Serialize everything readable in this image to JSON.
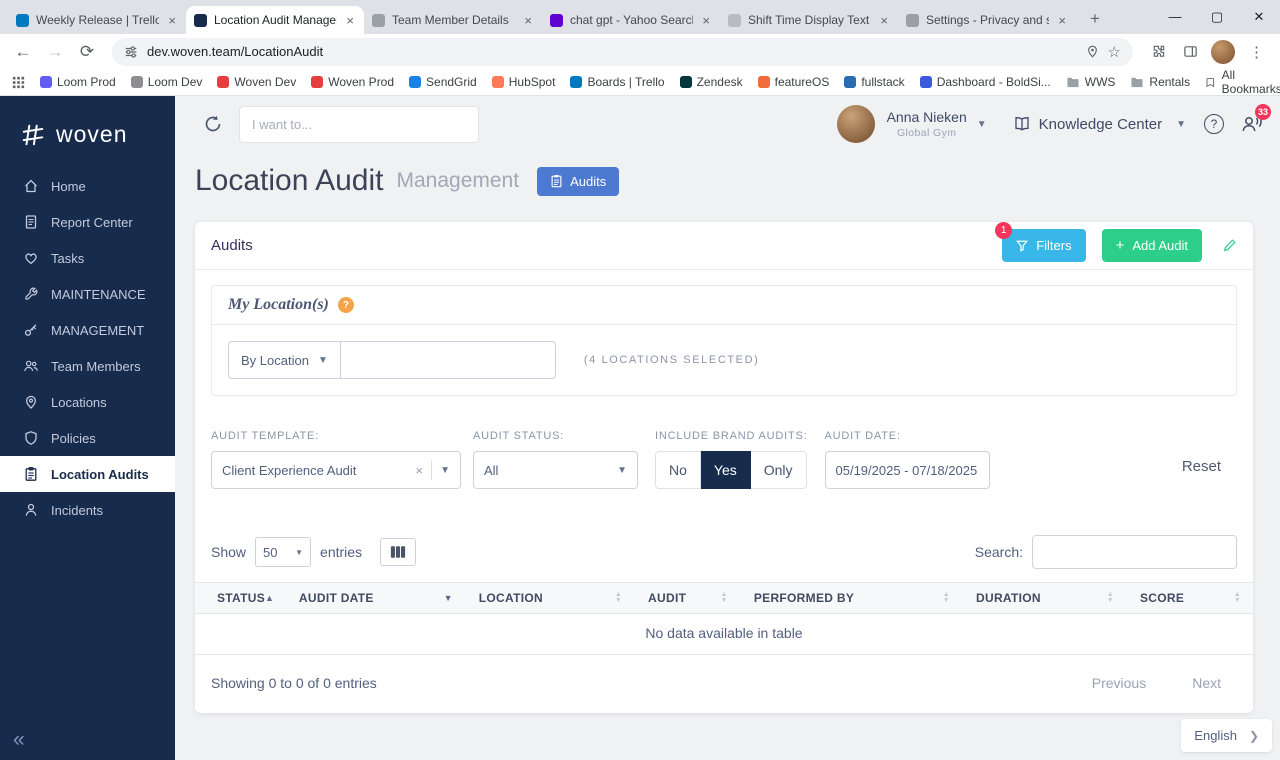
{
  "colors": {
    "sidebar_navy": "#172b4d",
    "chip_blue": "#4d7ad0",
    "filters_cyan": "#39b7e9",
    "add_green": "#2dce89",
    "badge_red": "#f5365c"
  },
  "browser": {
    "tabs": [
      {
        "title": "Weekly Release | Trello",
        "color": "#0079bf"
      },
      {
        "title": "Location Audit Managem...",
        "color": "#172b4d"
      },
      {
        "title": "Team Member Details",
        "color": "#9aa0a6"
      },
      {
        "title": "chat gpt - Yahoo Search Re...",
        "color": "#5f01d1"
      },
      {
        "title": "Shift Time Display Text",
        "color": "#b8bcc2"
      },
      {
        "title": "Settings - Privacy and secur...",
        "color": "#9aa0a6"
      }
    ],
    "url": "dev.woven.team/LocationAudit",
    "bookmarks": [
      {
        "label": "Loom Prod",
        "color": "#625df5"
      },
      {
        "label": "Loom Dev",
        "color": "#8d8d92"
      },
      {
        "label": "Woven Dev",
        "color": "#e53e3e"
      },
      {
        "label": "Woven Prod",
        "color": "#e53e3e"
      },
      {
        "label": "SendGrid",
        "color": "#1a82e2"
      },
      {
        "label": "HubSpot",
        "color": "#ff7a59"
      },
      {
        "label": "Boards | Trello",
        "color": "#0079bf"
      },
      {
        "label": "Zendesk",
        "color": "#03363d"
      },
      {
        "label": "featureOS",
        "color": "#f26b3a"
      },
      {
        "label": "fullstack",
        "color": "#2b6cb0"
      },
      {
        "label": "Dashboard - BoldSi...",
        "color": "#3b5bdb"
      },
      {
        "label": "WWS",
        "folder": true
      },
      {
        "label": "Rentals",
        "folder": true
      }
    ],
    "all_bookmarks": "All Bookmarks"
  },
  "sidebar": {
    "logo_text": "woven",
    "items": [
      {
        "label": "Home"
      },
      {
        "label": "Report Center"
      },
      {
        "label": "Tasks"
      },
      {
        "label": "MAINTENANCE"
      },
      {
        "label": "MANAGEMENT"
      },
      {
        "label": "Team Members"
      },
      {
        "label": "Locations"
      },
      {
        "label": "Policies"
      },
      {
        "label": "Location Audits"
      },
      {
        "label": "Incidents"
      }
    ]
  },
  "topbar": {
    "search_placeholder": "I want to...",
    "user_name": "Anna Nieken",
    "user_org": "Global Gym",
    "knowledge_center_label": "Knowledge Center",
    "notification_count": "33"
  },
  "page": {
    "title": "Location Audit",
    "subtitle": "Management",
    "chip_label": "Audits"
  },
  "audits_card": {
    "title": "Audits",
    "filters_button_label": "Filters",
    "filters_badge": "1",
    "add_button_label": "Add Audit",
    "my_locations": {
      "title": "My Location(s)",
      "by_location_label": "By Location",
      "selected_text": "(4 LOCATIONS SELECTED)"
    },
    "filters": {
      "template_label": "AUDIT TEMPLATE:",
      "template_value": "Client Experience Audit",
      "status_label": "AUDIT STATUS:",
      "status_value": "All",
      "brand_label": "INCLUDE BRAND AUDITS:",
      "brand_options": [
        "No",
        "Yes",
        "Only"
      ],
      "brand_selected": "Yes",
      "date_label": "AUDIT DATE:",
      "date_value": "05/19/2025 - 07/18/2025",
      "reset_label": "Reset"
    },
    "table": {
      "show_label": "Show",
      "show_value": "50",
      "entries_label": "entries",
      "search_label": "Search:",
      "columns": [
        "STATUS",
        "AUDIT DATE",
        "LOCATION",
        "AUDIT",
        "PERFORMED BY",
        "DURATION",
        "SCORE"
      ],
      "empty_text": "No data available in table",
      "footer_text": "Showing 0 to 0 of 0 entries",
      "prev_label": "Previous",
      "next_label": "Next"
    }
  },
  "language": {
    "label": "English"
  }
}
